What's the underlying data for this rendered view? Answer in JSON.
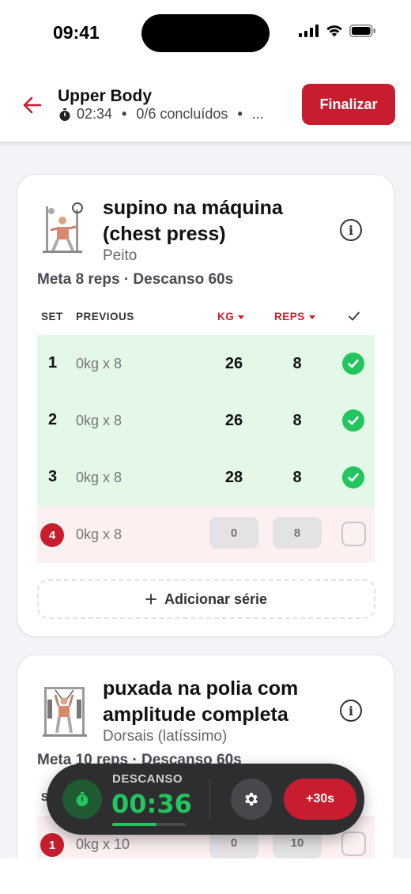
{
  "status_bar": {
    "time": "09:41"
  },
  "header": {
    "title": "Upper Body",
    "elapsed": "02:34",
    "progress": "0/6 concluídos",
    "more": "...",
    "finish_label": "Finalizar",
    "accent": "#c81d2e"
  },
  "columns": {
    "set": "SET",
    "previous": "PREVIOUS",
    "kg": "KG",
    "reps": "REPS"
  },
  "exercises": [
    {
      "name": "supino na máquina (chest press)",
      "muscle": "Peito",
      "meta": "Meta 8 reps · Descanso 60s",
      "sets": [
        {
          "num": "1",
          "previous": "0kg x 8",
          "kg": "26",
          "reps": "8",
          "done": true
        },
        {
          "num": "2",
          "previous": "0kg x 8",
          "kg": "26",
          "reps": "8",
          "done": true
        },
        {
          "num": "3",
          "previous": "0kg x 8",
          "kg": "28",
          "reps": "8",
          "done": true
        },
        {
          "num": "4",
          "previous": "0kg x 8",
          "kg": "0",
          "reps": "8",
          "done": false
        }
      ],
      "add_set_label": "Adicionar série"
    },
    {
      "name": "puxada na polia com amplitude completa",
      "muscle": "Dorsais (latíssimo)",
      "meta": "Meta 10 reps · Descanso 60s",
      "sets": [
        {
          "num": "1",
          "previous": "0kg x 10",
          "kg": "0",
          "reps": "10",
          "done": false
        }
      ]
    }
  ],
  "rest_timer": {
    "label": "DESCANSO",
    "value": "00:36",
    "progress": 0.6,
    "add_label": "+30s",
    "color": "#22c55e"
  }
}
